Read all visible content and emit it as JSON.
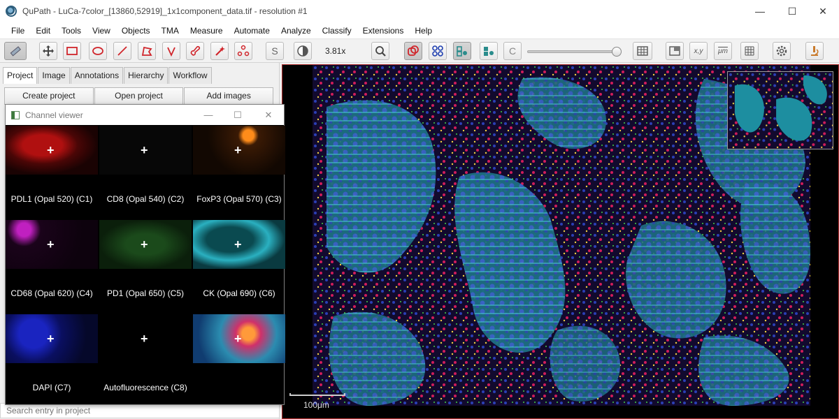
{
  "window": {
    "title": "QuPath - LuCa-7color_[13860,52919]_1x1component_data.tif - resolution #1",
    "minimize_glyph": "—",
    "maximize_glyph": "☐",
    "close_glyph": "✕"
  },
  "menu": [
    "File",
    "Edit",
    "Tools",
    "View",
    "Objects",
    "TMA",
    "Measure",
    "Automate",
    "Analyze",
    "Classify",
    "Extensions",
    "Help"
  ],
  "toolbar": {
    "zoom": "3.81x",
    "text_tool_label": "S",
    "cell_tool_label": "C",
    "coords_label": "x,y",
    "scale_label": "μm",
    "accent_color": "#d0252b",
    "selection_color": "#1f3fb0",
    "teal_color": "#2a8c8c",
    "opacity_value": 0.95
  },
  "left_panel": {
    "tabs": [
      "Project",
      "Image",
      "Annotations",
      "Hierarchy",
      "Workflow"
    ],
    "active_tab": "Project",
    "buttons": [
      "Create project",
      "Open project",
      "Add images"
    ],
    "search_placeholder": "Search entry in project"
  },
  "channel_viewer": {
    "title": "Channel viewer",
    "channels": [
      {
        "label": "PDL1 (Opal 520) (C1)",
        "color": "#ff2a2a"
      },
      {
        "label": "CD8 (Opal 540) (C2)",
        "color": "#ffff00"
      },
      {
        "label": "FoxP3 (Opal 570) (C3)",
        "color": "#ff8c00"
      },
      {
        "label": "CD68 (Opal 620) (C4)",
        "color": "#ff00ff"
      },
      {
        "label": "PD1 (Opal 650) (C5)",
        "color": "#00ff00"
      },
      {
        "label": "CK (Opal 690) (C6)",
        "color": "#00ffff"
      },
      {
        "label": "DAPI (C7)",
        "color": "#0000ff"
      },
      {
        "label": "Autofluorescence (C8)",
        "color": "#000000"
      },
      {
        "label": "",
        "color": "composite"
      }
    ]
  },
  "viewer": {
    "scale_bar_label": "100μm"
  }
}
